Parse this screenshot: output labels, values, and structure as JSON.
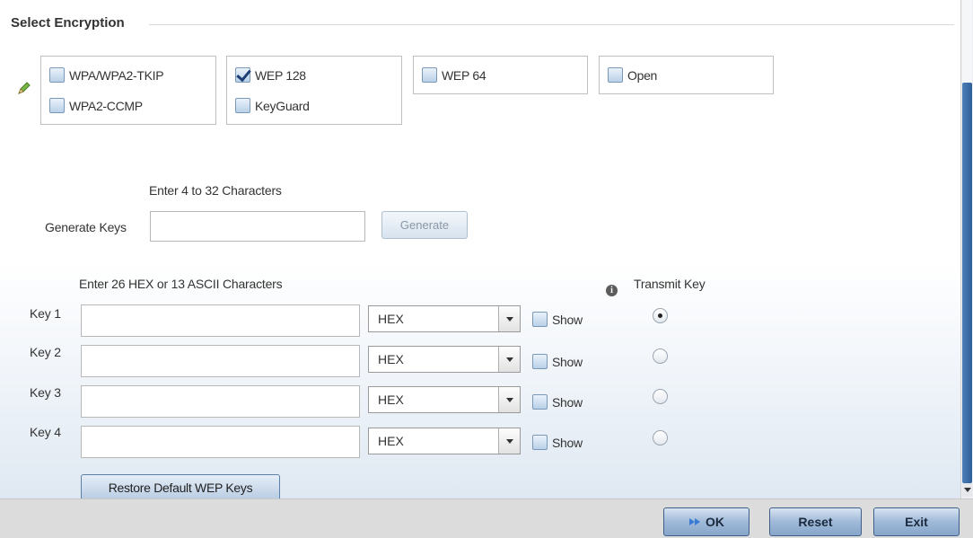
{
  "section": {
    "title": "Select Encryption"
  },
  "encryption": {
    "group1": [
      {
        "label": "WPA/WPA2-TKIP",
        "checked": false
      },
      {
        "label": "WPA2-CCMP",
        "checked": false
      }
    ],
    "group2": [
      {
        "label": "WEP 128",
        "checked": true
      },
      {
        "label": "KeyGuard",
        "checked": false
      }
    ],
    "group3": [
      {
        "label": "WEP 64",
        "checked": false
      }
    ],
    "group4": [
      {
        "label": "Open",
        "checked": false
      }
    ]
  },
  "generate": {
    "hint": "Enter 4 to 32 Characters",
    "label": "Generate Keys",
    "value": "",
    "button": "Generate"
  },
  "keys": {
    "hint": "Enter 26 HEX or 13 ASCII Characters",
    "transmit_label": "Transmit Key",
    "info_icon": "info-icon",
    "show_label": "Show",
    "rows": [
      {
        "label": "Key 1",
        "value": "",
        "format": "HEX",
        "show": false,
        "transmit": true
      },
      {
        "label": "Key 2",
        "value": "",
        "format": "HEX",
        "show": false,
        "transmit": false
      },
      {
        "label": "Key 3",
        "value": "",
        "format": "HEX",
        "show": false,
        "transmit": false
      },
      {
        "label": "Key 4",
        "value": "",
        "format": "HEX",
        "show": false,
        "transmit": false
      }
    ],
    "restore_button": "Restore Default WEP Keys"
  },
  "footer": {
    "ok": "OK",
    "reset": "Reset",
    "exit": "Exit"
  },
  "colors": {
    "accent": "#2f5f99",
    "button_border": "#3f5f88",
    "footer_bg": "#dcdcdc"
  }
}
